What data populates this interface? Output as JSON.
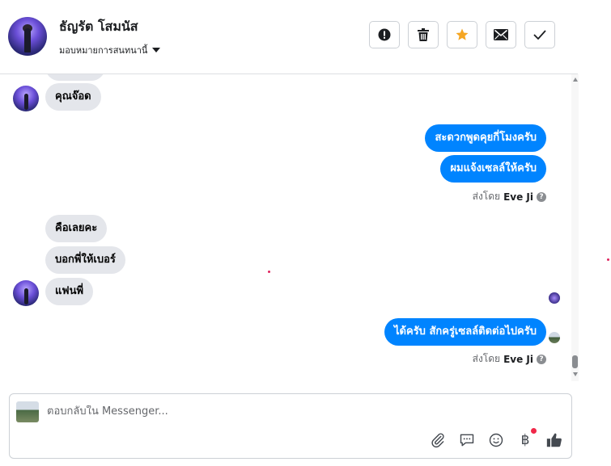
{
  "header": {
    "name": "ธัญรัต โสมนัส",
    "subtitle": "มอบหมายการสนทนานี้"
  },
  "toolbar": {
    "buttons": [
      "report-icon",
      "trash-icon",
      "star-icon",
      "envelope-icon",
      "check-icon"
    ],
    "star_color": "#f5a623"
  },
  "messages": {
    "incoming_1": "คุณจ๊อด",
    "outgoing_1": "สะดวกพูดคุยกี่โมงครับ",
    "outgoing_2": "ผมแจ้งเซลล์ให้ครับ",
    "sent_by_1": {
      "prefix": "ส่งโดย",
      "agent": "Eve Ji"
    },
    "incoming_2": "คือเลยคะ",
    "incoming_3": "บอกพี่ให้เบอร์",
    "incoming_4": "แฟนพี่",
    "outgoing_3": "ได้ครับ สักครู่เซลล์ติดต่อไปครับ",
    "sent_by_2": {
      "prefix": "ส่งโดย",
      "agent": "Eve Ji"
    }
  },
  "composer": {
    "placeholder": "ตอบกลับใน Messenger...",
    "tools": [
      "paperclip-icon",
      "chat-bubble-icon",
      "emoji-icon",
      "baht-icon",
      "thumbs-up-icon"
    ]
  },
  "colors": {
    "outgoing_bubble": "#0084ff",
    "incoming_bubble": "#e4e6eb"
  }
}
